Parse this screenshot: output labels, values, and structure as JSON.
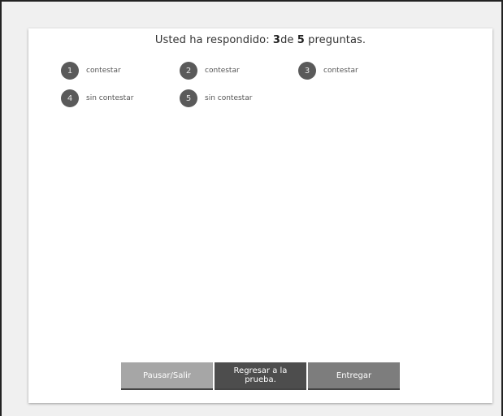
{
  "summary": {
    "prefix": "Usted ha respondido: ",
    "answered": "3",
    "middle": "de ",
    "total": "5",
    "suffix": " preguntas."
  },
  "questions": [
    {
      "number": "1",
      "status": "contestar"
    },
    {
      "number": "2",
      "status": "contestar"
    },
    {
      "number": "3",
      "status": "contestar"
    },
    {
      "number": "4",
      "status": "sin contestar"
    },
    {
      "number": "5",
      "status": "sin contestar"
    }
  ],
  "buttons": {
    "pause": "Pausar/Salir",
    "back": "Regresar a la prueba.",
    "submit": "Entregar"
  },
  "colors": {
    "circle": "#5a5a5a",
    "pause_button": "#a6a6a6",
    "back_button": "#4d4d4d",
    "submit_button": "#7d7d7d"
  }
}
